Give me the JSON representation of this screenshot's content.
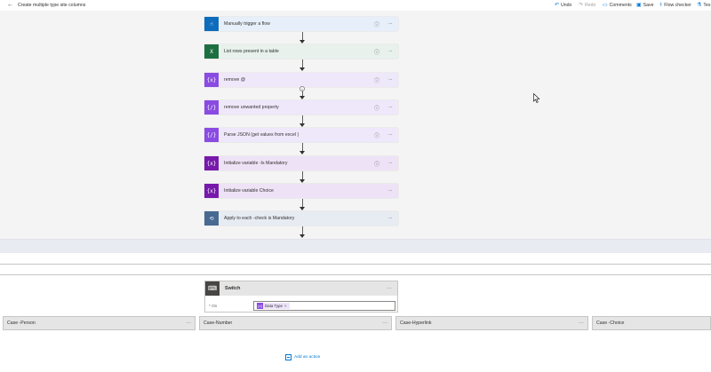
{
  "header": {
    "back_icon": "back-arrow-icon",
    "title": "Create multiple type site columns",
    "actions": [
      {
        "label": "Undo",
        "icon": "undo-icon",
        "enabled": true
      },
      {
        "label": "Redo",
        "icon": "redo-icon",
        "enabled": false
      },
      {
        "label": "Comments",
        "icon": "comment-icon",
        "enabled": true
      },
      {
        "label": "Save",
        "icon": "save-icon",
        "enabled": true
      },
      {
        "label": "Flow checker",
        "icon": "flow-checker-icon",
        "enabled": true
      },
      {
        "label": "Tes",
        "icon": "test-icon",
        "enabled": true
      }
    ]
  },
  "flow": {
    "steps": [
      {
        "label": "Manually trigger a flow",
        "icon": "trigger-hand-icon",
        "icon_glyph": "☝",
        "icon_bg": "#0f6cbd",
        "card_bg": "#e7f0fa",
        "info": true
      },
      {
        "label": "List rows present in a table",
        "icon": "excel-icon",
        "icon_glyph": "X",
        "icon_bg": "#1d6f42",
        "card_bg": "#e8f1ec",
        "info": true
      },
      {
        "label": "remove @",
        "icon": "variable-expression-icon",
        "icon_glyph": "{x}",
        "icon_bg": "#8a4be3",
        "card_bg": "#efe8fb",
        "info": true
      },
      {
        "label": "remove unwanted property",
        "icon": "data-operation-icon",
        "icon_glyph": "{/}",
        "icon_bg": "#8a4be3",
        "card_bg": "#efe8fb",
        "info": true
      },
      {
        "label": "Parse JSON (get values from excel )",
        "icon": "parse-json-icon",
        "icon_glyph": "{/}",
        "icon_bg": "#8a4be3",
        "card_bg": "#efe8fb",
        "info": true
      },
      {
        "label": "Initialize variable -Is Mandatory",
        "icon": "variable-icon",
        "icon_glyph": "{x}",
        "icon_bg": "#7719aa",
        "card_bg": "#eee3f6",
        "info": true
      },
      {
        "label": "Initialize variable Choice",
        "icon": "variable-icon",
        "icon_glyph": "{x}",
        "icon_bg": "#7719aa",
        "card_bg": "#eee3f6",
        "info": false
      },
      {
        "label": "Apply to each -check is Mandatory",
        "icon": "loop-icon",
        "icon_glyph": "⟲",
        "icon_bg": "#486991",
        "card_bg": "#e7ecf3",
        "info": false
      }
    ],
    "more_label": "···",
    "info_label": "ⓘ"
  },
  "switch": {
    "label": "Switch",
    "icon": "switch-icon",
    "on_label": "* On",
    "token_label": "Data Type",
    "token_remove": "×",
    "cases": [
      {
        "label": "Case -Person"
      },
      {
        "label": "Case-Number"
      },
      {
        "label": "Case-Hyperlink"
      },
      {
        "label": "Case -Choice"
      }
    ]
  },
  "add_action": {
    "label": "Add an action",
    "icon": "add-action-icon"
  }
}
